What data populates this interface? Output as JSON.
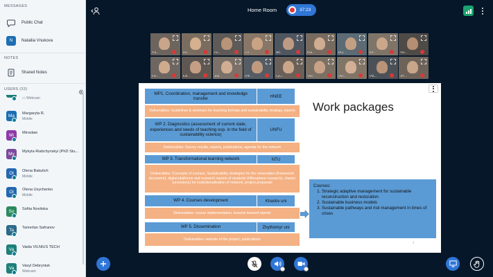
{
  "sidebar": {
    "messages_title": "MESSAGES",
    "public_chat": "Public Chat",
    "private_chat": {
      "initial": "N",
      "name": "Nataliia Vnukova"
    },
    "notes_title": "NOTES",
    "shared_notes": "Shared Notes",
    "users_title": "USERS (33)",
    "first_user_sub": "Webcam",
    "users": [
      {
        "initial": "Ma",
        "name": "Margaryta R.",
        "sub": "Mobile",
        "color": "#1c6fb3"
      },
      {
        "initial": "Mi",
        "name": "Miroslaw",
        "sub": "",
        "color": "#8e3aa8"
      },
      {
        "initial": "My",
        "name": "Mykyta Riabchynskyi (PhD Stu...",
        "sub": "",
        "color": "#7b4a9c"
      },
      {
        "initial": "Ol",
        "name": "Olena Bakulich",
        "sub": "Mobile",
        "color": "#2468b0"
      },
      {
        "initial": "Ol",
        "name": "Olena Usychenko",
        "sub": "Mobile",
        "color": "#2468b0"
      },
      {
        "initial": "So",
        "name": "Sofiia Novitska",
        "sub": "",
        "color": "#2b8a5e"
      },
      {
        "initial": "Ta",
        "name": "Tamerlan Safranov",
        "sub": "",
        "color": "#2b6a8a"
      },
      {
        "initial": "Va",
        "name": "Vaida VILNIUS TECH",
        "sub": "",
        "color": "#1e7f7a"
      },
      {
        "initial": "Va",
        "name": "Vasyl Debryniuk",
        "sub": "Webcam",
        "color": "#1e7f7a"
      }
    ]
  },
  "topbar": {
    "title": "Home Room",
    "rec_time": "37:23"
  },
  "tiles": [
    {
      "name": "Ga...",
      "face": "#c9a58a",
      "bg": "#6c645d"
    },
    {
      "name": "Ha...",
      "face": "#d4b08f",
      "bg": "#7a6d60"
    },
    {
      "name": "An...",
      "face": "#b89478",
      "bg": "#5d5a57"
    },
    {
      "name": "An...",
      "face": "#caa385",
      "bg": "#887766"
    },
    {
      "name": "Bil...",
      "face": "#bd9b82",
      "bg": "#4f5660"
    },
    {
      "name": "Dia...",
      "face": "#d0ad90",
      "bg": "#776b5f"
    },
    {
      "name": "Dia...",
      "face": "#c39f83",
      "bg": "#5c6b74"
    },
    {
      "name": "Ed...",
      "face": "#caa78b",
      "bg": "#7f7468"
    },
    {
      "name": "Ge...",
      "face": "#b58e72",
      "bg": "#4e4a47"
    },
    {
      "name": "Ine...",
      "face": "#cfab8e",
      "bg": "#6e6660"
    },
    {
      "name": "Iuli...",
      "face": "#c49f86",
      "bg": "#5f5852"
    },
    {
      "name": "Jak...",
      "face": "#d1ae93",
      "bg": "#7b7168"
    },
    {
      "name": "Khl...",
      "face": "#bf9a7f",
      "bg": "#555c63"
    },
    {
      "name": "Lyu...",
      "face": "#cba68a",
      "bg": "#6a6058"
    },
    {
      "name": "Vas...",
      "face": "#c7a286",
      "bg": "#7b7064"
    },
    {
      "name": "Vas...",
      "face": "#d3b095",
      "bg": "#817567"
    },
    {
      "name": "Vla...",
      "face": "#b99479",
      "bg": "#4c5158"
    },
    {
      "name": "Zh...",
      "face": "#c9a589",
      "bg": "#6d6359"
    }
  ],
  "slide": {
    "title": "Work packages",
    "page_number": "7",
    "packages": [
      {
        "head": "WP1. Coordination, management and knowledge transfer",
        "org": "HNEE",
        "deliv": "Deliverables: Guidelines & seminars for teaching formats and sustainability strategy, reports"
      },
      {
        "head": "WP 2. Diagnostics (assessment of current state, experiences and needs of teaching esp. in the field of sustainability science)",
        "org": "UNFU",
        "deliv": "Deliverables: Survey results, reports, publications, agenda for the network"
      },
      {
        "head": "WP 3. Transformational learning network",
        "org": "NTU",
        "deliv": "Deliverables: Concepts of courses, Sustainability strategies for the universities (framework document), digital platforms and research reports of students (#Biosphere research), charter (provisions) for institutionalisation of network, project proposals"
      },
      {
        "head": "WP 4. Courses development",
        "org": "Kharkiv uni",
        "deliv": "Deliverables: course implementation, lessons learned reports"
      },
      {
        "head": "WP 5. Dissemination",
        "org": "Zhythomyr uni",
        "deliv": "Deliverables: website of the project, publications"
      }
    ],
    "courses_heading": "Courses:",
    "courses": [
      "Strategic adaptive management for sustainable reconstruction and restoration",
      "Sustainable business models",
      "Sustainable pathways and risk management in times of crises"
    ]
  },
  "colors": {
    "accent": "#2f76d6",
    "wp_blue": "#5b9bd5",
    "wp_orange": "#f4b183",
    "signal_green": "#1aa36f"
  }
}
